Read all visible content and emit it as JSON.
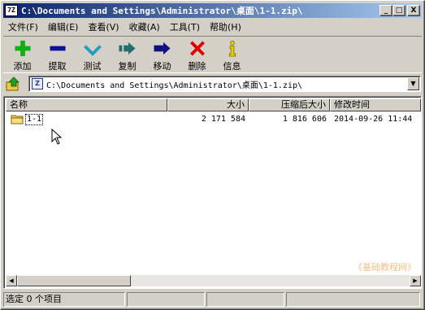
{
  "window": {
    "title": "C:\\Documents and Settings\\Administrator\\桌面\\1-1.zip\\",
    "app_icon_text": "7Z"
  },
  "titlebar_buttons": {
    "minimize": "_",
    "maximize": "□",
    "close": "X"
  },
  "menu": [
    {
      "label": "文件(F)"
    },
    {
      "label": "编辑(E)"
    },
    {
      "label": "查看(V)"
    },
    {
      "label": "收藏(A)"
    },
    {
      "label": "工具(T)"
    },
    {
      "label": "帮助(H)"
    }
  ],
  "toolbar": [
    {
      "label": "添加",
      "icon": "plus-icon",
      "color": "#10b010"
    },
    {
      "label": "提取",
      "icon": "minus-icon",
      "color": "#1010a0"
    },
    {
      "label": "测试",
      "icon": "check-icon",
      "color": "#20a0c0"
    },
    {
      "label": "复制",
      "icon": "copy-arrow-icon",
      "color": "#207070"
    },
    {
      "label": "移动",
      "icon": "move-arrow-icon",
      "color": "#101080"
    },
    {
      "label": "删除",
      "icon": "delete-x-icon",
      "color": "#e00000"
    },
    {
      "label": "信息",
      "icon": "info-icon",
      "color": "#e8d000"
    }
  ],
  "address": {
    "path": "C:\\Documents and Settings\\Administrator\\桌面\\1-1.zip\\"
  },
  "list": {
    "columns": [
      "名称",
      "大小",
      "压缩后大小",
      "修改时间"
    ],
    "rows": [
      {
        "name": "1-1",
        "size": "2 171 584",
        "packed": "1 816 606",
        "modified": "2014-09-26 11:44"
      }
    ]
  },
  "watermark": "《基础教程网》",
  "status": {
    "selection": "选定 0 个项目"
  }
}
